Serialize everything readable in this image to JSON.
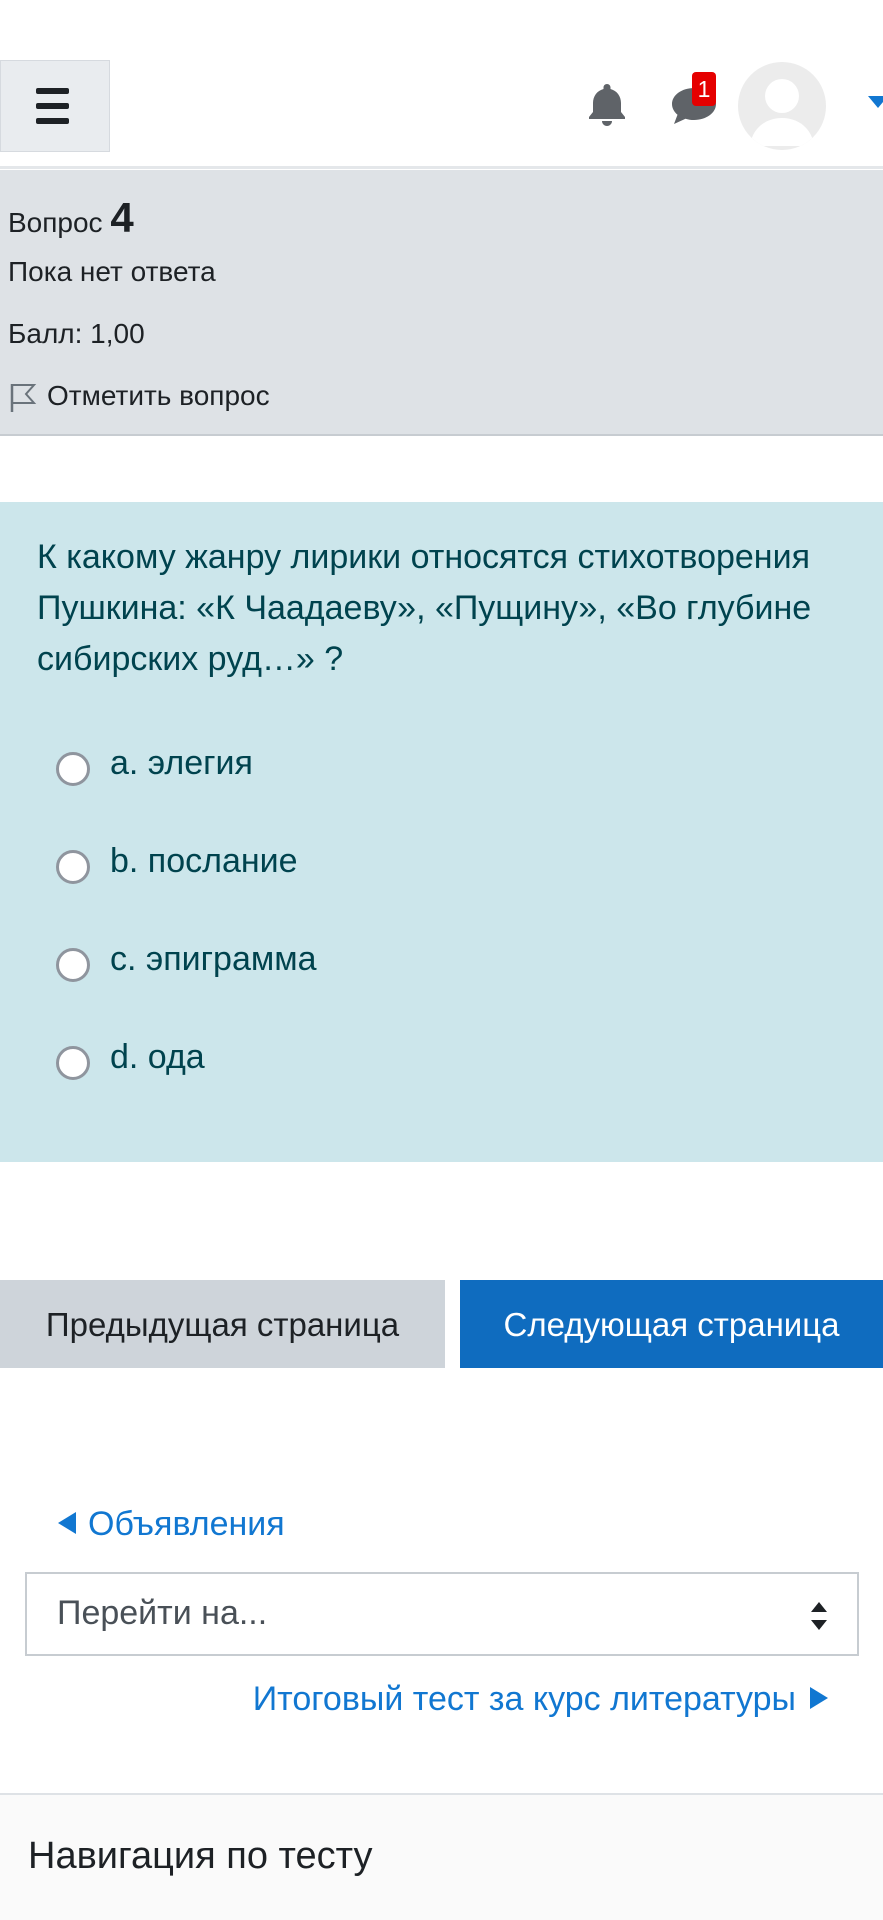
{
  "header": {
    "menu_icon": "hamburger-icon",
    "bell_icon": "bell-icon",
    "chat_icon": "chat-bubbles-icon",
    "message_count": "1",
    "avatar_icon": "user-avatar-icon",
    "dropdown_icon": "caret-down-icon"
  },
  "question_info": {
    "label": "Вопрос",
    "number": "4",
    "state": "Пока нет ответа",
    "grade": "Балл: 1,00",
    "flag_label": "Отметить вопрос",
    "flag_icon": "flag-icon"
  },
  "question": {
    "text": "К какому жанру лирики относятся стихотворения Пушкина: «К Чаадаеву», «Пущину», «Во глубине сибирских руд…» ?",
    "options": [
      {
        "label": "a. элегия",
        "selected": false
      },
      {
        "label": "b. послание",
        "selected": false
      },
      {
        "label": "c. эпиграмма",
        "selected": false
      },
      {
        "label": "d. ода",
        "selected": false
      }
    ]
  },
  "navigation": {
    "prev_button": "Предыдущая страница",
    "next_button": "Следующая страница"
  },
  "activity_nav": {
    "prev_activity": "Объявления",
    "jump_placeholder": "Перейти на...",
    "next_activity": "Итоговый тест за курс литературы"
  },
  "quiz_nav": {
    "title": "Навигация по тесту"
  },
  "colors": {
    "accent": "#0f6cbf",
    "link": "#1177d1",
    "question_bg": "#cce6eb",
    "info_bg": "#dee2e6",
    "badge": "#e50000"
  }
}
